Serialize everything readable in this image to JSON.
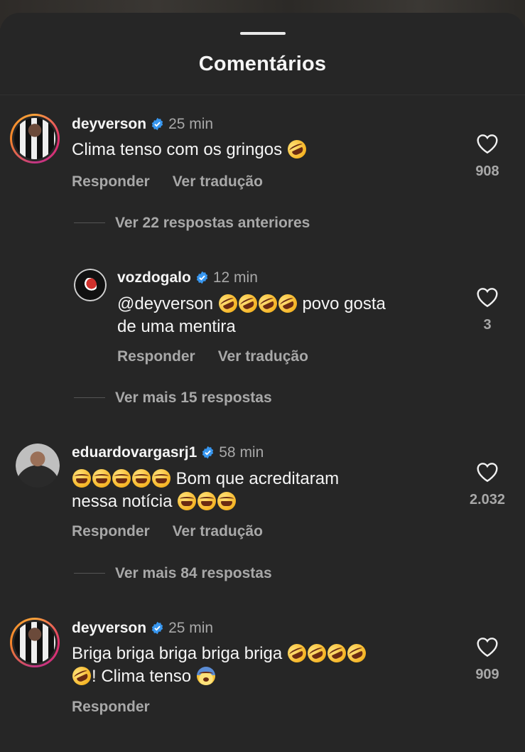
{
  "sheet": {
    "title": "Comentários"
  },
  "comments": [
    {
      "username": "deyverson",
      "time": "25 min",
      "text": "Clima tenso com os gringos",
      "like_count": "908",
      "reply_label": "Responder",
      "translate_label": "Ver tradução",
      "view_previous_replies": "Ver 22 respostas anteriores"
    },
    {
      "username": "vozdogalo",
      "time": "12 min",
      "text_line1": "@deyverson",
      "text_line1_tail": "povo gosta",
      "text_line2": "de uma mentira",
      "like_count": "3",
      "reply_label": "Responder",
      "translate_label": "Ver tradução",
      "view_more_replies": "Ver mais 15 respostas"
    },
    {
      "username": "eduardovargasrj1",
      "time": "58 min",
      "text_line1": "Bom que acreditaram",
      "text_line2": "nessa notícia",
      "like_count": "2.032",
      "reply_label": "Responder",
      "translate_label": "Ver tradução",
      "view_more_replies": "Ver mais 84 respostas"
    },
    {
      "username": "deyverson",
      "time": "25 min",
      "text_line1": "Briga briga briga briga briga",
      "text_line2": "! Clima tenso",
      "like_count": "909",
      "reply_label": "Responder"
    }
  ],
  "icons": {
    "heart": "heart-outline-icon",
    "verified": "verified-badge-icon"
  },
  "colors": {
    "background": "#262626",
    "text_primary": "#f5f5f5",
    "text_secondary": "#a8a8a8",
    "verified_blue": "#3897f0"
  }
}
